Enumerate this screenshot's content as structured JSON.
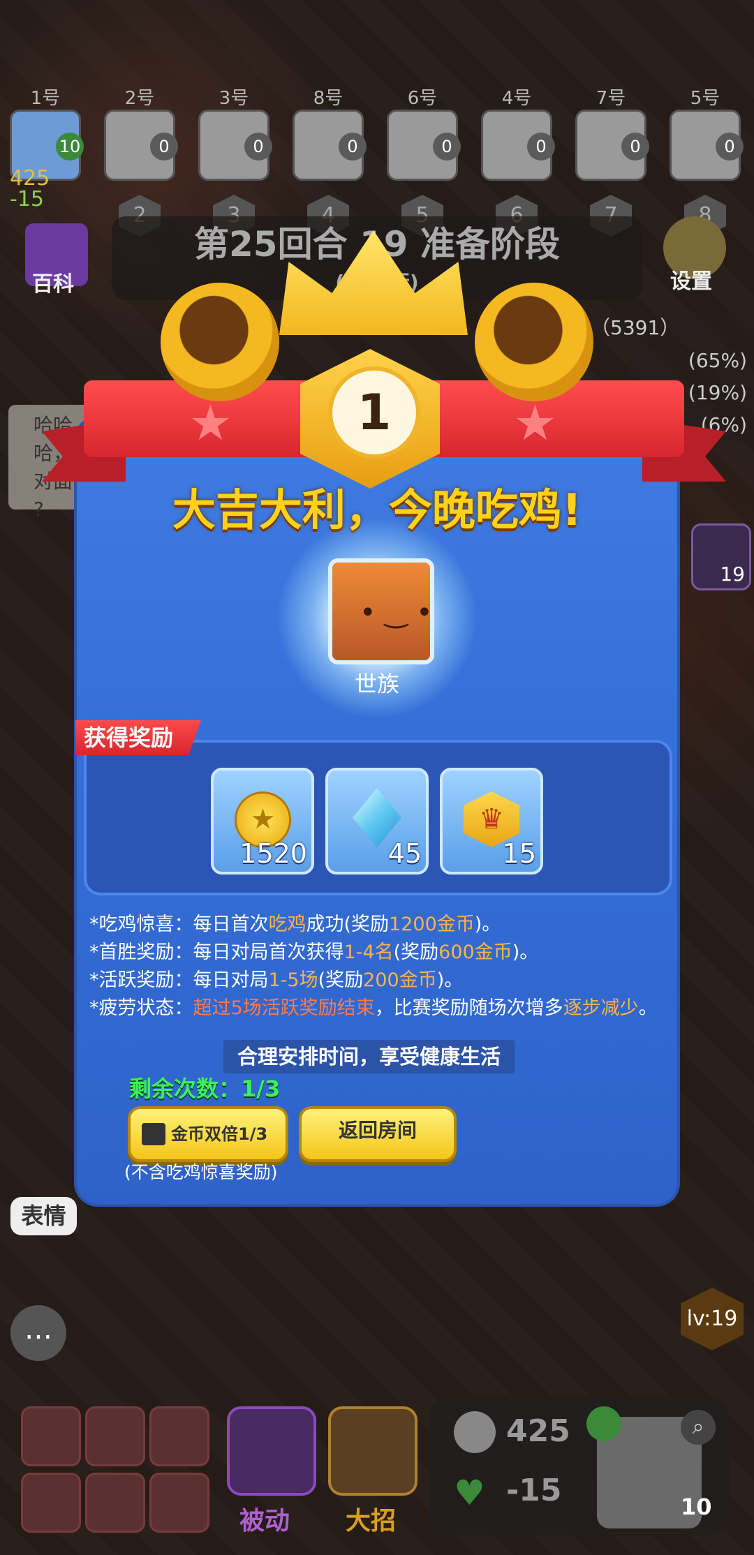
{
  "players": [
    {
      "label": "1号",
      "hp": "10",
      "rank": ""
    },
    {
      "label": "2号",
      "hp": "0",
      "rank": "2"
    },
    {
      "label": "3号",
      "hp": "0",
      "rank": "3"
    },
    {
      "label": "8号",
      "hp": "0",
      "rank": "4"
    },
    {
      "label": "6号",
      "hp": "0",
      "rank": "5"
    },
    {
      "label": "4号",
      "hp": "0",
      "rank": "6"
    },
    {
      "label": "7号",
      "hp": "0",
      "rank": "7"
    },
    {
      "label": "5号",
      "hp": "0",
      "rank": "8"
    }
  ],
  "self_stats": {
    "coins": "425",
    "hp_change": "-15"
  },
  "top": {
    "encyclopedia": "百科",
    "settings": "设置",
    "phase": "第25回合 19 准备阶段",
    "subphase": "(点 排行)",
    "damage_header": "伤害（5391）",
    "damage_rows": [
      "(65%)",
      "(19%)",
      "(6%)"
    ]
  },
  "chat_bubble": "哈哈哈，\n对面\n?",
  "side_count": "19",
  "modal": {
    "rank": "1",
    "headline": "大吉大利，今晚吃鸡!",
    "hero_name": "世族",
    "reward_tag": "获得奖励",
    "rewards": [
      {
        "icon": "coin-icon",
        "qty": "1520"
      },
      {
        "icon": "diamond-icon",
        "qty": "45"
      },
      {
        "icon": "crown-medal-icon",
        "qty": "15"
      }
    ],
    "rules": [
      {
        "a": "*吃鸡惊喜：每日首次",
        "b": "吃鸡",
        "c": "成功(奖励",
        "d": "1200金币",
        "e": ")。"
      },
      {
        "a": "*首胜奖励：每日对局首次获得",
        "b": "1-4名",
        "c": "(奖励",
        "d": "600金币",
        "e": ")。"
      },
      {
        "a": "*活跃奖励：每日对局",
        "b": "1-5场",
        "c": "(奖励",
        "d": "200金币",
        "e": ")。"
      },
      {
        "a": "*疲劳状态：",
        "b": "超过5场活跃奖励结束",
        "c": "，比赛奖励随场次增多",
        "d": "逐步减少",
        "e": "。"
      }
    ],
    "healthy": "合理安排时间，享受健康生活",
    "remaining": "剩余次数：1/3",
    "double_btn": "金币双倍1/3",
    "return_btn": "返回房间",
    "note": "(不含吃鸡惊喜奖励)"
  },
  "bottom": {
    "emote": "表情",
    "passive": "被动",
    "ultimate": "大招",
    "coins": "425",
    "hp_change": "-15",
    "level": "lv:19",
    "hero_hp": "10"
  },
  "colors": {
    "modal_blue": "#3470d8",
    "gold": "#ffd21a",
    "ribbon_red": "#d8262f",
    "green": "#3cf25a",
    "orange": "#ffb24a"
  }
}
